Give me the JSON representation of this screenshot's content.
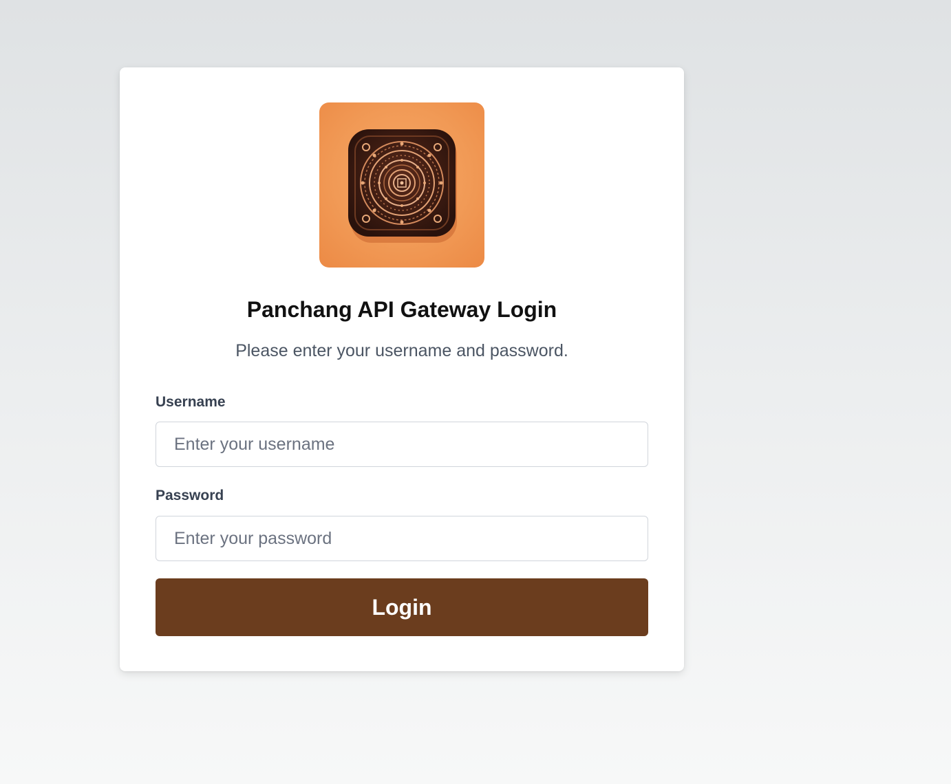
{
  "login": {
    "logo_icon": "mandala-app-icon",
    "title": "Panchang API Gateway Login",
    "subtitle": "Please enter your username and password.",
    "username_label": "Username",
    "username_placeholder": "Enter your username",
    "username_value": "",
    "password_label": "Password",
    "password_placeholder": "Enter your password",
    "password_value": "",
    "login_button": "Login"
  },
  "colors": {
    "button_bg": "#6b3d1e",
    "logo_bg": "#f19a56"
  }
}
